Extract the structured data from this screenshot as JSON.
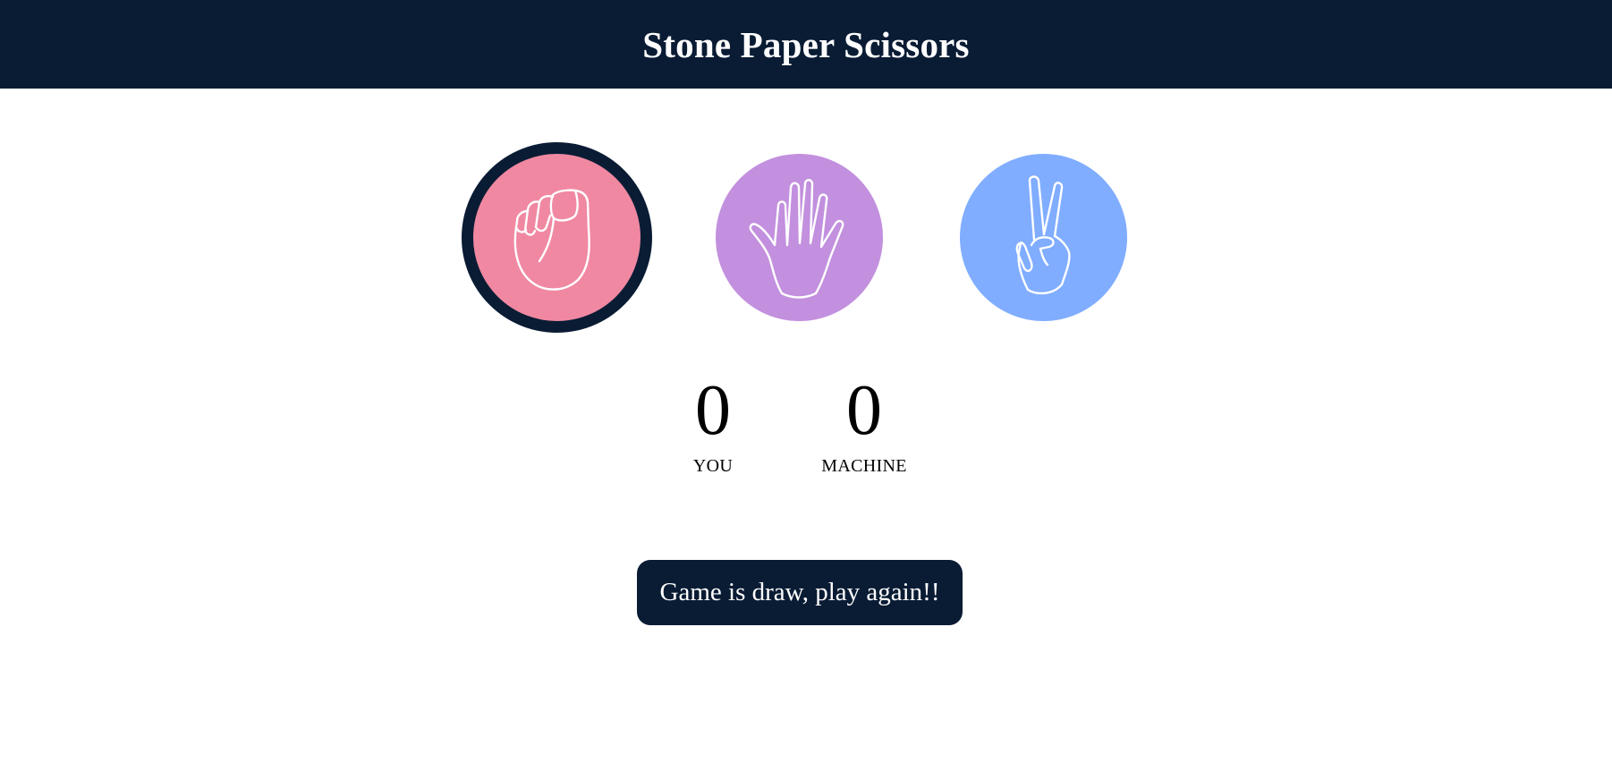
{
  "header": {
    "title": "Stone Paper Scissors"
  },
  "choices": [
    {
      "id": "stone",
      "icon": "fist-icon",
      "color": "#f088a2",
      "selected": true
    },
    {
      "id": "paper",
      "icon": "open-hand-icon",
      "color": "#c290de",
      "selected": false
    },
    {
      "id": "scissors",
      "icon": "peace-sign-icon",
      "color": "#80adff",
      "selected": false
    }
  ],
  "scoreboard": {
    "user": {
      "score": "0",
      "label": "YOU"
    },
    "machine": {
      "score": "0",
      "label": "MACHINE"
    }
  },
  "message": {
    "text": "Game is draw, play again!!"
  },
  "colors": {
    "primary": "#0a1c34",
    "background": "#ffffff"
  }
}
